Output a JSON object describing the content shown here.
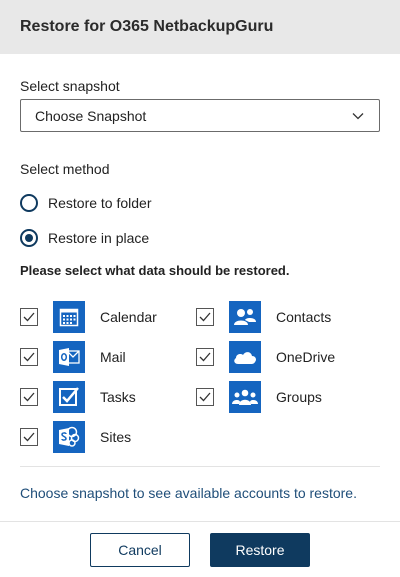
{
  "header": {
    "title": "Restore for O365 NetbackupGuru"
  },
  "snapshot": {
    "label": "Select snapshot",
    "value": "Choose Snapshot"
  },
  "method": {
    "label": "Select method",
    "options": [
      {
        "label": "Restore to folder",
        "checked": false
      },
      {
        "label": "Restore in place",
        "checked": true
      }
    ]
  },
  "data_section": {
    "label": "Please select what data should be restored.",
    "items": [
      {
        "label": "Calendar",
        "icon": "calendar-icon",
        "checked": true
      },
      {
        "label": "Contacts",
        "icon": "contacts-icon",
        "checked": true
      },
      {
        "label": "Mail",
        "icon": "outlook-mail-icon",
        "checked": true
      },
      {
        "label": "OneDrive",
        "icon": "onedrive-icon",
        "checked": true
      },
      {
        "label": "Tasks",
        "icon": "tasks-icon",
        "checked": true
      },
      {
        "label": "Groups",
        "icon": "groups-icon",
        "checked": true
      },
      {
        "label": "Sites",
        "icon": "sharepoint-sites-icon",
        "checked": true
      }
    ]
  },
  "info_text": "Choose snapshot to see available accounts to restore.",
  "footer": {
    "cancel_label": "Cancel",
    "restore_label": "Restore"
  },
  "colors": {
    "primary": "#0f3a5f",
    "icon_bg": "#1565c0",
    "header_bg": "#e8e8e8",
    "info_text": "#1f4e79"
  }
}
